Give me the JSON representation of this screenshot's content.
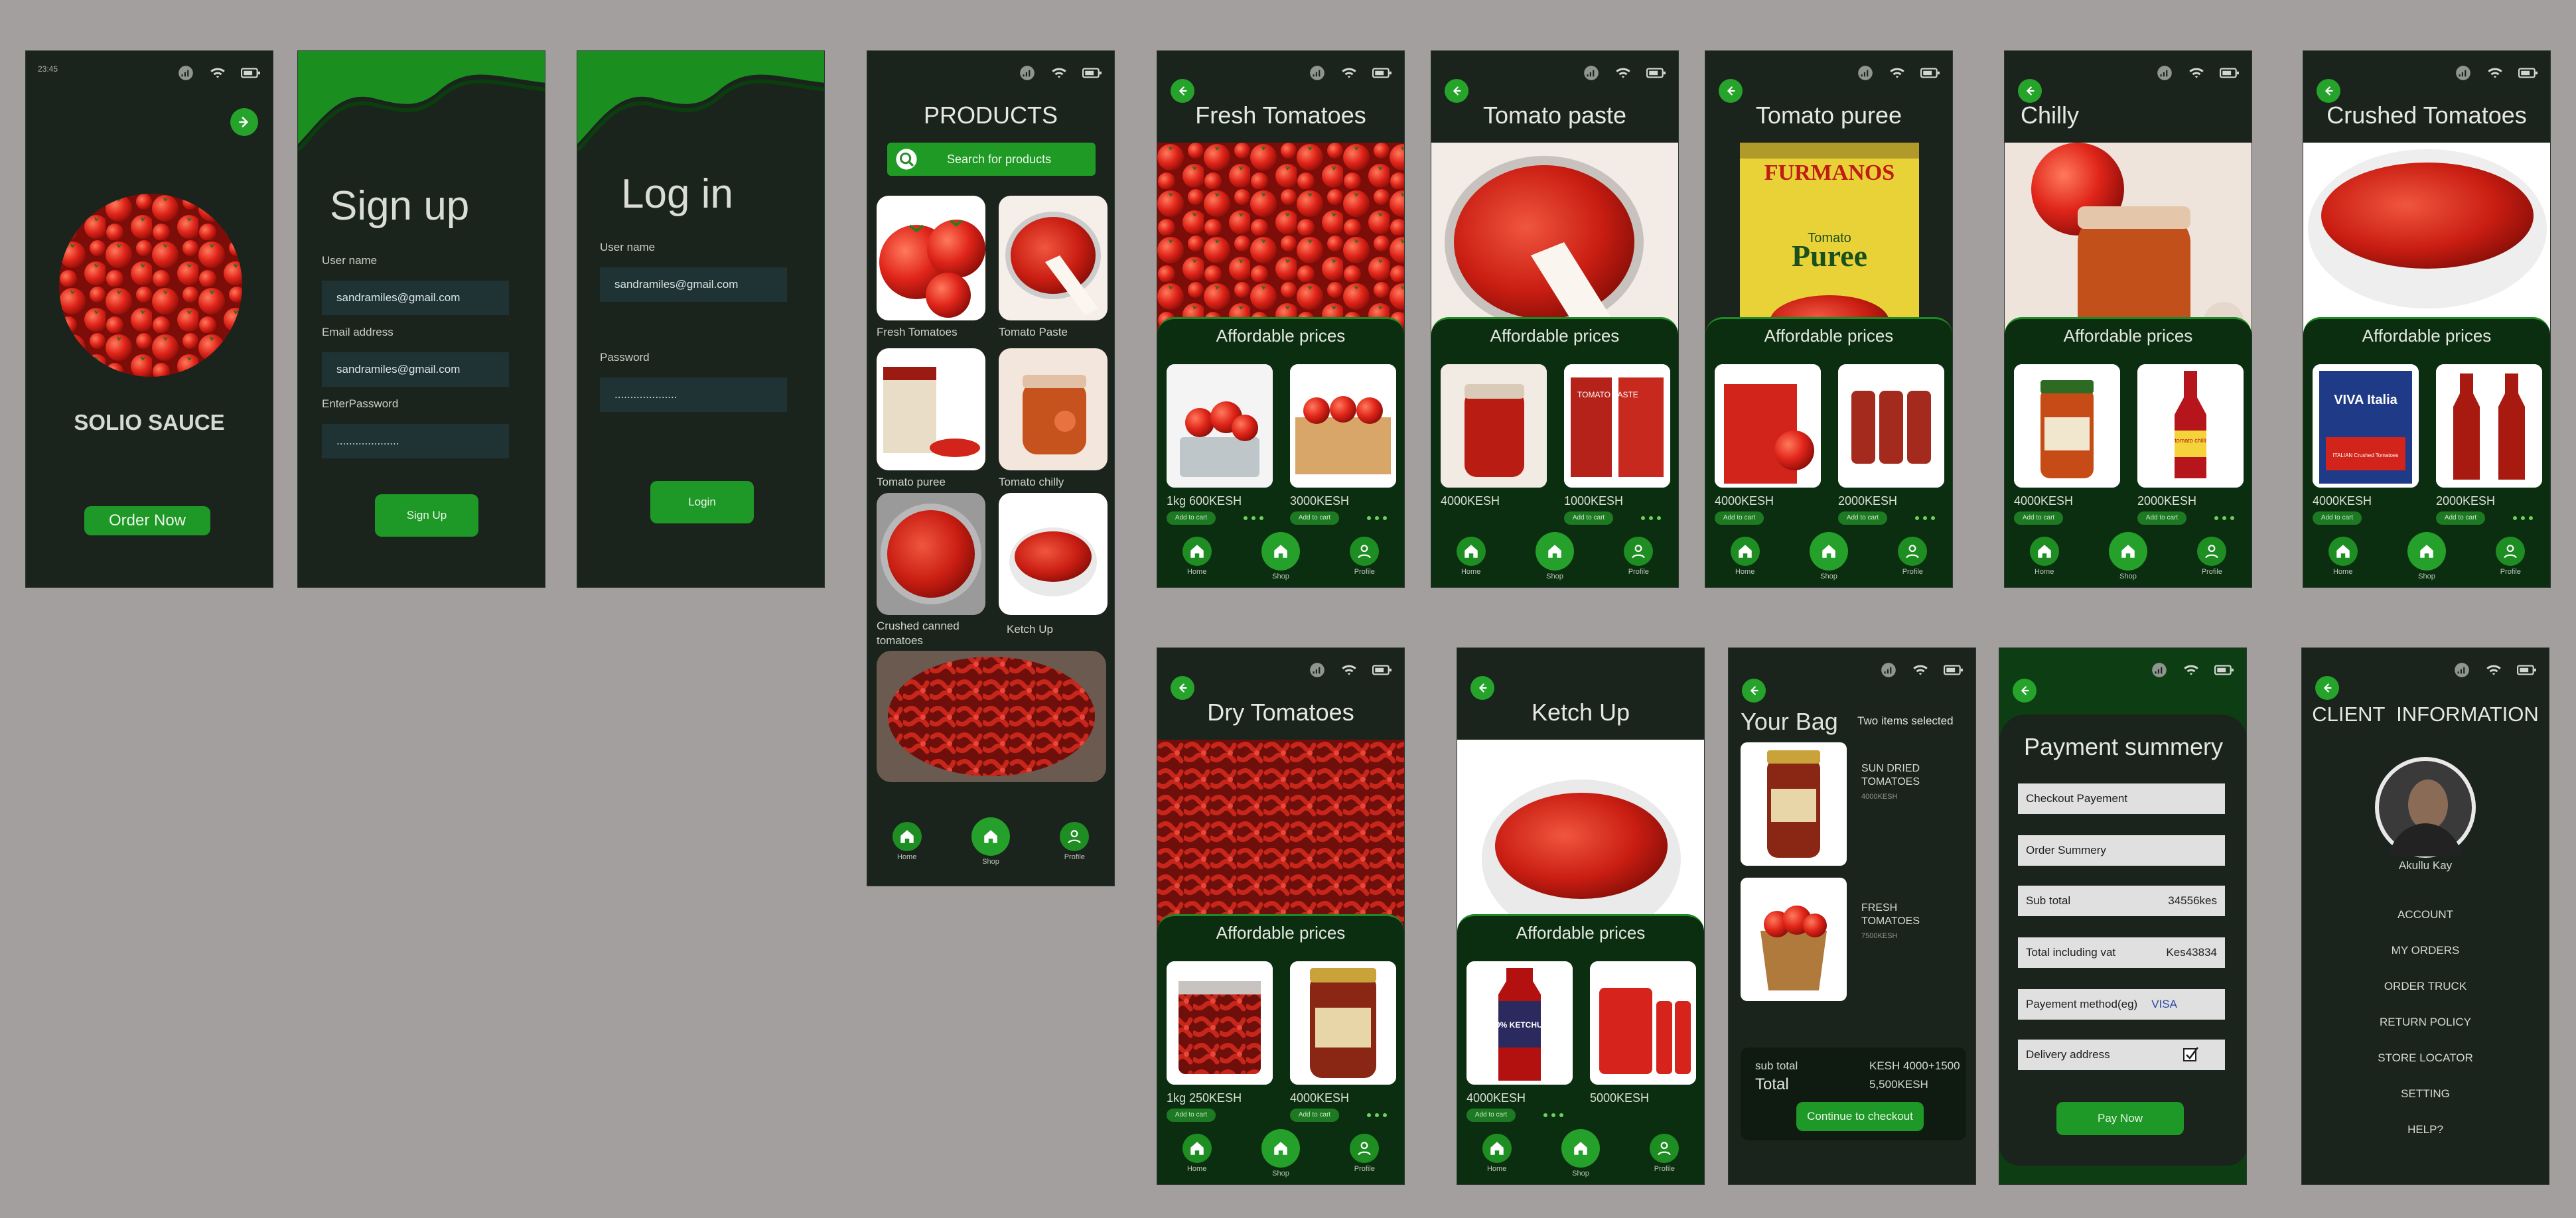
{
  "status": {
    "time": "23:45"
  },
  "welcome": {
    "brand": "SOLIO SAUCE",
    "order_button": "Order Now"
  },
  "signup": {
    "title": "Sign up",
    "username_label": "User name",
    "username_value": "sandramiles@gmail.com",
    "email_label": "Email address",
    "email_value": "sandramiles@gmail.com",
    "password_label": "EnterPassword",
    "password_value": "....................",
    "button": "Sign Up"
  },
  "login": {
    "title": "Log in",
    "username_label": "User name",
    "username_value": "sandramiles@gmail.com",
    "password_label": "Password",
    "password_value": "....................",
    "button": "Login"
  },
  "products": {
    "title": "PRODUCTS",
    "search_placeholder": "Search for products",
    "items": [
      {
        "label": "Fresh Tomatoes"
      },
      {
        "label": "Tomato Paste"
      },
      {
        "label": "Tomato puree"
      },
      {
        "label": "Tomato chilly"
      },
      {
        "label": "Crushed canned tomatoes"
      },
      {
        "label": "Ketch Up"
      }
    ]
  },
  "nav": {
    "home": "Home",
    "shop": "Shop",
    "profile": "Profile"
  },
  "panel_title": "Affordable prices",
  "add_to_cart": "Add to cart",
  "detail_pages": [
    {
      "title": "Fresh Tomatoes",
      "price1": "1kg 600KESH",
      "price2": "3000KESH"
    },
    {
      "title": "Tomato paste",
      "price1": "4000KESH",
      "price2": "1000KESH"
    },
    {
      "title": "Tomato puree",
      "price1": "4000KESH",
      "price2": "2000KESH"
    },
    {
      "title": "Chilly",
      "price1": "4000KESH",
      "price2": "2000KESH"
    },
    {
      "title": "Crushed Tomatoes",
      "price1": "4000KESH",
      "price2": "2000KESH"
    },
    {
      "title": "Dry Tomatoes",
      "price1": "1kg 250KESH",
      "price2": "4000KESH"
    },
    {
      "title": "Ketch Up",
      "price1": "4000KESH",
      "price2": "5000KESH"
    }
  ],
  "product_texts": {
    "puree_can_brand": "FURMANOS",
    "puree_can_sub": "Tomato",
    "puree_can_name": "Puree",
    "paste_can": "TOMATO PASTE",
    "crushed_can": "VIVA Italia",
    "crushed_sub": "ITALIAN Crushed Tomatoes",
    "chilli_bottle": "tomato chilli",
    "ketchup_bottle": "50% KETCHUP"
  },
  "bag": {
    "title": "Your Bag",
    "subtitle": "Two items selected",
    "items": [
      {
        "name": "SUN DRIED TOMATOES",
        "price": "4000KESH"
      },
      {
        "name": "FRESH TOMATOES",
        "price": "7500KESH"
      }
    ],
    "subtotal_label": "sub total",
    "subtotal_value": "KESH 4000+1500",
    "total_label": "Total",
    "total_value": "5,500KESH",
    "checkout_button": "Continue to checkout"
  },
  "payment": {
    "title": "Payment summery",
    "rows": [
      {
        "label": "Checkout Payement",
        "value": ""
      },
      {
        "label": "Order Summery",
        "value": ""
      },
      {
        "label": "Sub total",
        "value": "34556kes"
      },
      {
        "label": "Total including vat",
        "value": "Kes43834"
      },
      {
        "label": "Payement method(eg)",
        "value": "VISA"
      },
      {
        "label": "Delivery address",
        "value": ""
      }
    ],
    "pay_button": "Pay Now"
  },
  "client": {
    "title": "CLIENT  INFORMATION",
    "name": "Akullu Kay",
    "menu": [
      "ACCOUNT",
      "MY ORDERS",
      "ORDER TRUCK",
      "RETURN POLICY",
      "STORE LOCATOR",
      "SETTING",
      "HELP?"
    ]
  },
  "colors": {
    "accent": "#1e9826",
    "background": "#1b231d",
    "panel": "#0c2e10",
    "page": "#a39f9e"
  }
}
